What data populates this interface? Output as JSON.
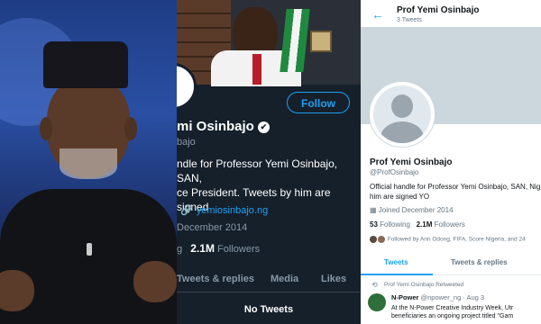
{
  "dark_profile": {
    "follow_label": "Follow",
    "name": "mi Osinbajo",
    "handle": "bajo",
    "bio_line1": "ndle for Professor Yemi Osinbajo, SAN,",
    "bio_line2": "ce President. Tweets by him are signed",
    "website": "yemiosinbajo.ng",
    "joined": "December 2014",
    "following_partial": "g",
    "followers_count": "2.1M",
    "followers_label": "Followers",
    "tabs": [
      "Tweets & replies",
      "Media",
      "Likes"
    ],
    "no_tweets": "No Tweets"
  },
  "light_profile": {
    "header_name": "Prof Yemi Osinbajo",
    "tweet_count": "3 Tweets",
    "name": "Prof Yemi Osinbajo",
    "handle": "@ProfOsinbajo",
    "bio_line1": "Official handle for Professor Yemi Osinbajo, SAN, Nig",
    "bio_line2": "him are signed YO",
    "joined": "Joined December 2014",
    "following_count": "53",
    "following_label": "Following",
    "followers_count": "2.1M",
    "followers_label": "Followers",
    "followed_by": "Followed by Ann Odong, FIFA, Score Nigeria, and 24",
    "tabs": [
      "Tweets",
      "Tweets & replies"
    ],
    "retweet_notice": "Prof Yemi Osinbajo Retweeted",
    "tweet_author": "N-Power",
    "tweet_handle": "@npower_ng · Aug 3",
    "tweet_line1": "At the N-Power Creative Industry Week, Utr",
    "tweet_line2": "beneficiaries an ongoing project titled \"Gam"
  },
  "colors": {
    "twitter_blue": "#1da1f2",
    "dark_bg": "#15202b",
    "light_bg": "#ffffff"
  }
}
